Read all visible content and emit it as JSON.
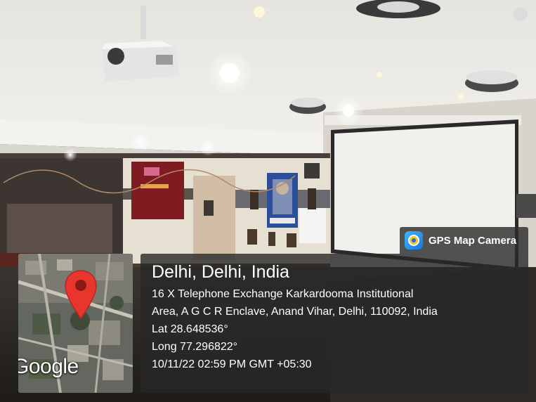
{
  "badge": {
    "app_name": "GPS Map Camera",
    "icon": "gps-map-camera-app-icon"
  },
  "location": {
    "title": "Delhi, Delhi, India",
    "address_line1": "16 X Telephone Exchange Karkardooma Institutional",
    "address_line2": "Area, A G C R Enclave, Anand Vihar, Delhi, 110092, India",
    "latitude": "Lat 28.648536°",
    "longitude": "Long 77.296822°",
    "timestamp": "10/11/22 02:59 PM GMT +05:30"
  },
  "map": {
    "brand_label": "Google",
    "pin_icon": "map-pin-icon",
    "pin_color": "#e8352d"
  },
  "colors": {
    "screen": "#f2f2ee",
    "ceiling": "#ecebe6",
    "wall": "#e8e3d8",
    "overlay": "#282828"
  }
}
